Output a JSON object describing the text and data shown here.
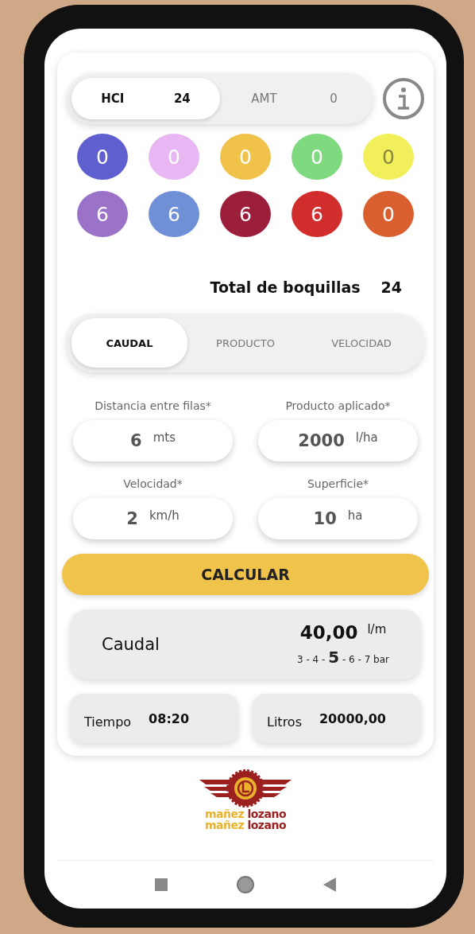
{
  "type_tabs": [
    {
      "label": "HCI",
      "count": "24",
      "selected": true
    },
    {
      "label": "AMT",
      "count": "0",
      "selected": false
    }
  ],
  "nozzles": [
    {
      "count": "0",
      "color": "#5f5fcf"
    },
    {
      "count": "0",
      "color": "#e8b6f2"
    },
    {
      "count": "0",
      "color": "#f0c24a"
    },
    {
      "count": "0",
      "color": "#7fd97f"
    },
    {
      "count": "0",
      "color": "#f1ef5a"
    },
    {
      "count": "6",
      "color": "#9a72c8"
    },
    {
      "count": "6",
      "color": "#6f8fd6"
    },
    {
      "count": "6",
      "color": "#9b1f3b"
    },
    {
      "count": "6",
      "color": "#d12d2d"
    },
    {
      "count": "0",
      "color": "#d9602e"
    }
  ],
  "total": {
    "label": "Total de boquillas",
    "value": "24"
  },
  "mode_tabs": [
    {
      "label": "CAUDAL",
      "selected": true
    },
    {
      "label": "PRODUCTO",
      "selected": false
    },
    {
      "label": "VELOCIDAD",
      "selected": false
    }
  ],
  "fields": [
    {
      "label": "Distancia entre filas*",
      "value": "6",
      "unit": "mts"
    },
    {
      "label": "Producto aplicado*",
      "value": "2000",
      "unit": "l/ha"
    },
    {
      "label": "Velocidad*",
      "value": "2",
      "unit": "km/h"
    },
    {
      "label": "Superficie*",
      "value": "10",
      "unit": "ha"
    }
  ],
  "calculate_button": "CALCULAR",
  "result": {
    "label": "Caudal",
    "value": "40,00",
    "unit": "l/m",
    "pressures": "3 - 4 - **5** - 6 - 7 bar"
  },
  "summary": [
    {
      "label": "Tiempo",
      "value": "08:20"
    },
    {
      "label": "Litros",
      "value": "20000,00"
    }
  ],
  "logo_lines": [
    "mañez **lozano**",
    "mañez **lozano**"
  ]
}
